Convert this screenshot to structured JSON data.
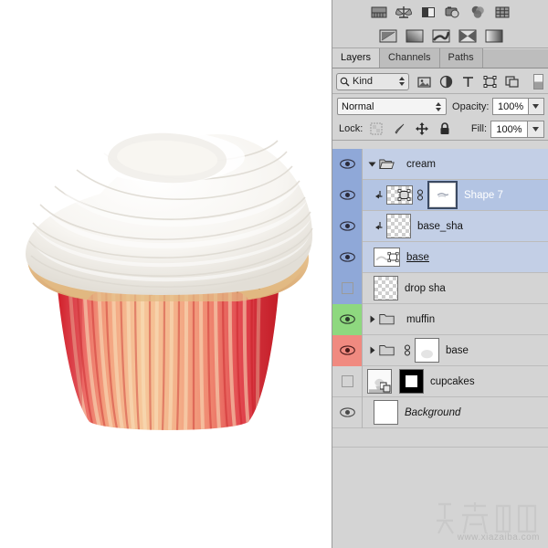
{
  "app": {
    "name": "Adobe Photoshop Layers Panel",
    "canvas_background": "#ffffff",
    "panel_background": "#d4d4d4"
  },
  "canvas": {
    "artwork_name": "cupcake-with-white-frosting",
    "artwork_alt": "Cupcake with white whipped frosting and red striped paper liner"
  },
  "toolbar": {
    "row1": [
      {
        "icon": "ruler-measure-icon",
        "label": "Measurement Scale"
      },
      {
        "icon": "balance-scale-icon",
        "label": "Scale"
      },
      {
        "icon": "split-panel-icon",
        "label": "Split View"
      },
      {
        "icon": "camera-icon",
        "label": "Snapshot"
      },
      {
        "icon": "color-channels-icon",
        "label": "Channels"
      },
      {
        "icon": "grid-icon",
        "label": "Grid"
      }
    ],
    "row2": [
      {
        "icon": "gradient-swatch-1-icon",
        "label": "Gradient Preset 1"
      },
      {
        "icon": "gradient-swatch-2-icon",
        "label": "Gradient Preset 2"
      },
      {
        "icon": "gradient-swatch-3-icon",
        "label": "Gradient Preset 3"
      },
      {
        "icon": "gradient-swatch-4-icon",
        "label": "Gradient Preset 4"
      },
      {
        "icon": "gradient-swatch-5-icon",
        "label": "Gradient Preset 5"
      }
    ]
  },
  "tabs": [
    {
      "label": "Layers",
      "active": true
    },
    {
      "label": "Channels",
      "active": false
    },
    {
      "label": "Paths",
      "active": false
    }
  ],
  "filter": {
    "search_icon": "magnifier-icon",
    "kind_label": "Kind",
    "stepper_icon": "up-down-arrows-icon",
    "filter_icons": [
      {
        "icon": "pixel-layer-filter-icon",
        "label": "Pixel Layers"
      },
      {
        "icon": "adjustment-layer-filter-icon",
        "label": "Adjustment Layers"
      },
      {
        "icon": "type-layer-filter-icon",
        "label": "Type Layers"
      },
      {
        "icon": "shape-layer-filter-icon",
        "label": "Shape Layers"
      },
      {
        "icon": "smart-object-filter-icon",
        "label": "Smart Objects"
      }
    ],
    "toggle_icon": "filter-toggle-switch-icon"
  },
  "blend": {
    "mode_value": "Normal",
    "mode_stepper_icon": "up-down-arrows-icon",
    "opacity_label": "Opacity:",
    "opacity_value": "100%",
    "opacity_stepper_icon": "chevron-down-icon"
  },
  "lock": {
    "label": "Lock:",
    "icons": [
      {
        "icon": "lock-transparency-icon",
        "label": "Lock Transparent Pixels"
      },
      {
        "icon": "lock-image-brush-icon",
        "label": "Lock Image Pixels"
      },
      {
        "icon": "lock-position-move-icon",
        "label": "Lock Position"
      },
      {
        "icon": "lock-all-padlock-icon",
        "label": "Lock All"
      }
    ],
    "fill_label": "Fill:",
    "fill_value": "100%",
    "fill_stepper_icon": "chevron-down-icon"
  },
  "layers": [
    {
      "name": "cream",
      "type": "group",
      "visible": true,
      "expanded": true,
      "selected": true,
      "eye_color": "#8fa8d8",
      "row_color": "#c3cfe6",
      "indent": 0,
      "has_folder": true,
      "has_disclosure": true,
      "disclosure_state": "open",
      "thumb": "none"
    },
    {
      "name": "Shape 7",
      "type": "shape",
      "visible": true,
      "selected": true,
      "active": true,
      "eye_color": "#8fa8d8",
      "row_color": "#b3c4e3",
      "indent": 1,
      "clipped": true,
      "linked": true,
      "thumb": "vector-mask",
      "name_color": "#ffffff"
    },
    {
      "name": "base_sha",
      "type": "pixel",
      "visible": true,
      "selected": true,
      "eye_color": "#8fa8d8",
      "row_color": "#c3cfe6",
      "indent": 1,
      "clipped": true,
      "thumb": "transparent"
    },
    {
      "name": "base",
      "type": "shape",
      "visible": true,
      "selected": true,
      "renaming": true,
      "eye_color": "#8fa8d8",
      "row_color": "#c3cfe6",
      "indent": 0,
      "thumb": "white-shape"
    },
    {
      "name": "drop sha",
      "type": "pixel",
      "visible": false,
      "selected": true,
      "eye_color": "#8fa8d8",
      "row_color": "#d4d4d4",
      "indent": 0,
      "thumb": "transparent"
    },
    {
      "name": "muffin",
      "type": "group",
      "visible": true,
      "expanded": false,
      "eye_color": "#8ed87f",
      "row_color": "#d4d4d4",
      "indent": 0,
      "has_folder": true,
      "has_disclosure": true,
      "disclosure_state": "closed",
      "thumb": "none"
    },
    {
      "name": "base",
      "type": "group",
      "visible": true,
      "expanded": false,
      "eye_color": "#f08a80",
      "row_color": "#d4d4d4",
      "indent": 0,
      "has_folder": true,
      "has_disclosure": true,
      "disclosure_state": "closed",
      "linked": true,
      "thumb": "white-blob"
    },
    {
      "name": "cupcakes",
      "type": "smart-object",
      "visible": false,
      "eye_color": "#d4d4d4",
      "row_color": "#d4d4d4",
      "indent": 0,
      "thumb": "smart-object",
      "has_mask": true,
      "mask": "black-with-white-square"
    },
    {
      "name": "Background",
      "type": "background",
      "visible": true,
      "italic": true,
      "eye_color": "#d4d4d4",
      "row_color": "#d4d4d4",
      "indent": 0,
      "thumb": "white"
    }
  ],
  "watermark": {
    "logo_text": "下载吧",
    "url_text": "www.xiazaiba.com",
    "color": "#b9b9b9"
  },
  "colors": {
    "selected_row": "#b3c4e3",
    "selected_row_light": "#c3cfe6",
    "eye_blue": "#8fa8d8",
    "eye_green": "#8ed87f",
    "eye_red": "#f08a80",
    "panel_gray": "#d4d4d4",
    "tab_inactive": "#bdbdbd"
  }
}
